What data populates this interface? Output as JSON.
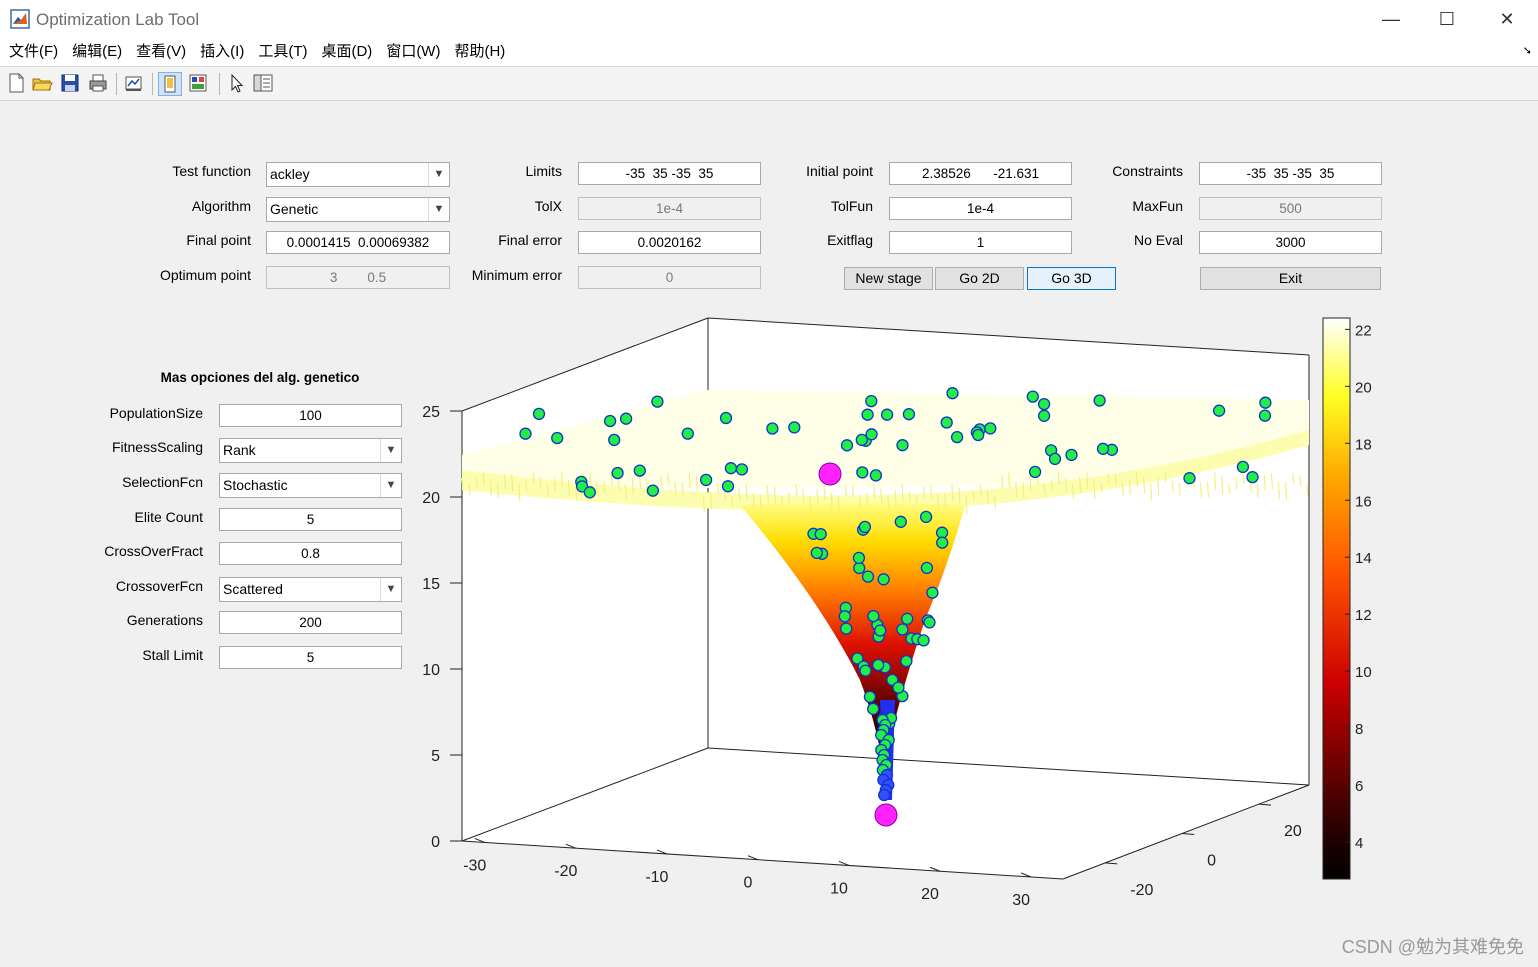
{
  "window": {
    "title": "Optimization Lab Tool",
    "minimize": "—",
    "maximize": "☐",
    "close": "✕"
  },
  "menu": [
    {
      "label": "文件(F)"
    },
    {
      "label": "编辑(E)"
    },
    {
      "label": "查看(V)"
    },
    {
      "label": "插入(I)"
    },
    {
      "label": "工具(T)"
    },
    {
      "label": "桌面(D)"
    },
    {
      "label": "窗口(W)"
    },
    {
      "label": "帮助(H)"
    }
  ],
  "toolbar": {
    "icons": [
      "new-figure-icon",
      "open-file-icon",
      "save-icon",
      "print-icon",
      "link-plot-icon",
      "hide-plot-tools-icon",
      "show-plot-tools-icon",
      "edit-plot-pointer-icon",
      "property-inspector-icon"
    ]
  },
  "form": {
    "test_function": {
      "label": "Test function",
      "value": "ackley"
    },
    "algorithm": {
      "label": "Algorithm",
      "value": "Genetic"
    },
    "final_point": {
      "label": "Final point",
      "value": "0.0001415  0.00069382"
    },
    "optimum_point": {
      "label": "Optimum point",
      "value": "3        0.5"
    },
    "limits": {
      "label": "Limits",
      "value": "-35  35 -35  35"
    },
    "tolx": {
      "label": "TolX",
      "value": "1e-4"
    },
    "final_error": {
      "label": "Final error",
      "value": "0.0020162"
    },
    "minimum_error": {
      "label": "Minimum error",
      "value": "0"
    },
    "initial_point": {
      "label": "Initial point",
      "value": "2.38526      -21.631"
    },
    "tolfun": {
      "label": "TolFun",
      "value": "1e-4"
    },
    "exitflag": {
      "label": "Exitflag",
      "value": "1"
    },
    "constraints": {
      "label": "Constraints",
      "value": "-35  35 -35  35"
    },
    "maxfun": {
      "label": "MaxFun",
      "value": "500"
    },
    "no_eval": {
      "label": "No Eval",
      "value": "3000"
    },
    "buttons": {
      "new_stage": "New stage",
      "go_2d": "Go 2D",
      "go_3d": "Go 3D",
      "exit": "Exit"
    }
  },
  "ga_options": {
    "title": "Mas opciones del alg. genetico",
    "population_size": {
      "label": "PopulationSize",
      "value": "100"
    },
    "fitness_scaling": {
      "label": "FitnessScaling",
      "value": "Rank"
    },
    "selection_fcn": {
      "label": "SelectionFcn",
      "value": "Stochastic"
    },
    "elite_count": {
      "label": "Elite Count",
      "value": "5"
    },
    "crossover_fract": {
      "label": "CrossOverFract",
      "value": "0.8"
    },
    "crossover_fcn": {
      "label": "CrossoverFcn",
      "value": "Scattered"
    },
    "generations": {
      "label": "Generations",
      "value": "200"
    },
    "stall_limit": {
      "label": "Stall Limit",
      "value": "5"
    }
  },
  "chart_data": {
    "type": "surface",
    "z_ticks": [
      "0",
      "5",
      "10",
      "15",
      "20",
      "25"
    ],
    "x_ticks": [
      "-30",
      "-20",
      "-10",
      "0",
      "10",
      "20",
      "30"
    ],
    "y_ticks": [
      "-20",
      "0",
      "20"
    ],
    "colorbar_ticks": [
      "4",
      "6",
      "8",
      "10",
      "12",
      "14",
      "16",
      "18",
      "20",
      "22"
    ],
    "colormap": "hot",
    "marker_colors": {
      "population": "#22ee44",
      "population_edge": "#1133cc",
      "best": "#ff22ff"
    },
    "surface_color_top": "#ffffd0"
  },
  "watermark": "CSDN @勉为其难免免"
}
